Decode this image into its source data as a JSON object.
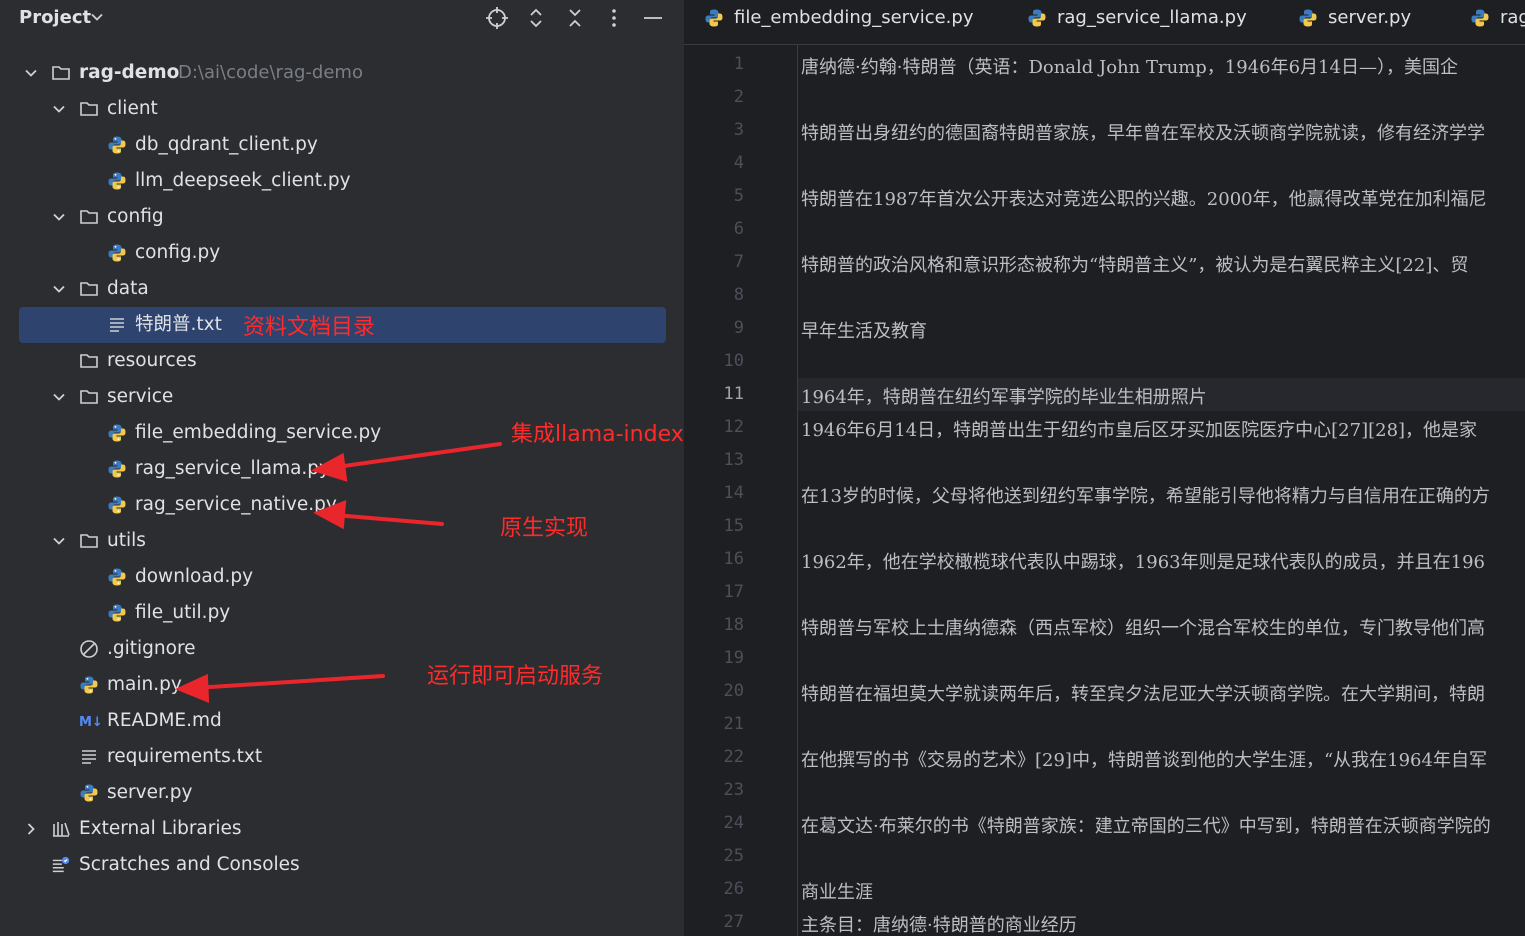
{
  "project_panel": {
    "title": "Project",
    "root": {
      "name": "rag-demo",
      "path": "D:\\ai\\code\\rag-demo"
    },
    "tree": [
      {
        "label": "client",
        "type": "folder"
      },
      {
        "label": "db_qdrant_client.py",
        "type": "python"
      },
      {
        "label": "llm_deepseek_client.py",
        "type": "python"
      },
      {
        "label": "config",
        "type": "folder"
      },
      {
        "label": "config.py",
        "type": "python"
      },
      {
        "label": "data",
        "type": "folder"
      },
      {
        "label": "特朗普.txt",
        "type": "text"
      },
      {
        "label": "resources",
        "type": "folder"
      },
      {
        "label": "service",
        "type": "folder"
      },
      {
        "label": "file_embedding_service.py",
        "type": "python"
      },
      {
        "label": "rag_service_llama.py",
        "type": "python"
      },
      {
        "label": "rag_service_native.py",
        "type": "python"
      },
      {
        "label": "utils",
        "type": "folder"
      },
      {
        "label": "download.py",
        "type": "python"
      },
      {
        "label": "file_util.py",
        "type": "python"
      },
      {
        "label": ".gitignore",
        "type": "ignore"
      },
      {
        "label": "main.py",
        "type": "python"
      },
      {
        "label": "README.md",
        "type": "markdown"
      },
      {
        "label": "requirements.txt",
        "type": "text"
      },
      {
        "label": "server.py",
        "type": "python"
      },
      {
        "label": "External Libraries",
        "type": "library"
      },
      {
        "label": "Scratches and Consoles",
        "type": "scratch"
      }
    ],
    "annotations": {
      "data_dir": "资料文档目录",
      "llama": "集成llama-index的实现",
      "native": "原生实现",
      "main": "运行即可启动服务"
    }
  },
  "editor": {
    "tabs": [
      "file_embedding_service.py",
      "rag_service_llama.py",
      "server.py",
      "rag"
    ],
    "current_line": 11,
    "line_numbers": [
      "1",
      "2",
      "3",
      "4",
      "5",
      "6",
      "7",
      "8",
      "9",
      "10",
      "11",
      "12",
      "13",
      "14",
      "15",
      "16",
      "17",
      "18",
      "19",
      "20",
      "21",
      "22",
      "23",
      "24",
      "25",
      "26",
      "27"
    ],
    "lines": [
      "唐纳德·约翰·特朗普（英语：Donald John Trump，1946年6月14日—），美国企",
      "",
      "特朗普出身纽约的德国裔特朗普家族，早年曾在军校及沃顿商学院就读，修有经济学学",
      "",
      "特朗普在1987年首次公开表达对竞选公职的兴趣。2000年，他赢得改革党在加利福尼",
      "",
      "特朗普的政治风格和意识形态被称为“特朗普主义”，被认为是右翼民粹主义[22]、贸",
      "",
      "早年生活及教育",
      "",
      "1964年，特朗普在纽约军事学院的毕业生相册照片",
      "1946年6月14日，特朗普出生于纽约市皇后区牙买加医院医疗中心[27][28]，他是家",
      "",
      "在13岁的时候，父母将他送到纽约军事学院，希望能引导他将精力与自信用在正确的方",
      "",
      "1962年，他在学校橄榄球代表队中踢球，1963年则是足球代表队的成员，并且在196",
      "",
      "特朗普与军校上士唐纳德森（西点军校）组织一个混合军校生的单位，专门教导他们高",
      "",
      "特朗普在福坦莫大学就读两年后，转至宾夕法尼亚大学沃顿商学院。在大学期间，特朗",
      "",
      "在他撰写的书《交易的艺术》[29]中，特朗普谈到他的大学生涯，“从我在1964年自军",
      "",
      "在葛文达·布莱尔的书《特朗普家族：建立帝国的三代》中写到，特朗普在沃顿商学院的",
      "",
      "商业生涯",
      "主条目：唐纳德·特朗普的商业经历"
    ]
  },
  "colors": {
    "annotation": "#ff2b2b",
    "selection": "#2e436e",
    "folder_icon": "#ced0d6",
    "python_blue": "#3b7bbf",
    "python_yellow": "#f2c94c"
  }
}
